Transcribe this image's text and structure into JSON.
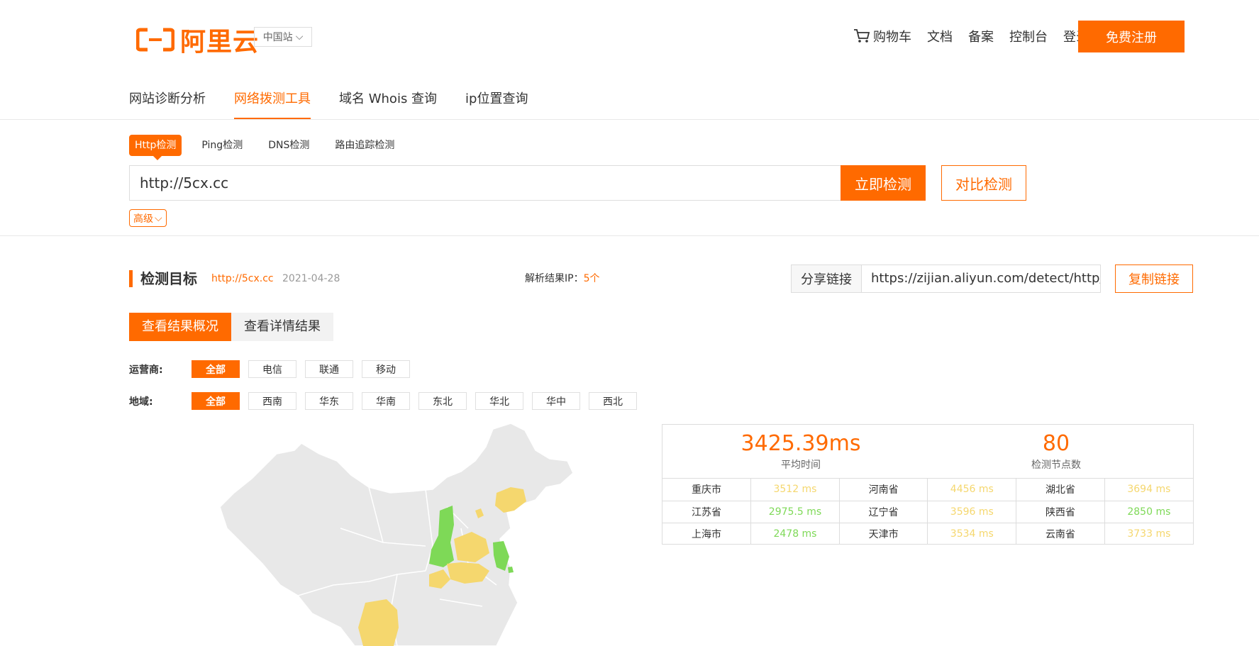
{
  "header": {
    "logo_text": "阿里云",
    "site_select": "中国站",
    "nav": {
      "cart": "购物车",
      "docs": "文档",
      "filing": "备案",
      "console": "控制台",
      "login": "登录"
    },
    "register_label": "免费注册"
  },
  "main_tabs": [
    "网站诊断分析",
    "网络拨测工具",
    "域名 Whois 查询",
    "ip位置查询"
  ],
  "sub_tabs": [
    "Http检测",
    "Ping检测",
    "DNS检测",
    "路由追踪检测"
  ],
  "search": {
    "value": "http://5cx.cc",
    "detect_label": "立即检测",
    "compare_label": "对比检测",
    "advanced_label": "高级"
  },
  "target": {
    "title": "检测目标",
    "url": "http://5cx.cc",
    "date": "2021-04-28",
    "ip_label": "解析结果IP：",
    "ip_count": "5个"
  },
  "share": {
    "label": "分享链接",
    "value": "https://zijian.aliyun.com/detect/http/HTT",
    "copy_label": "复制链接"
  },
  "view_tabs": [
    "查看结果概况",
    "查看详情结果"
  ],
  "filters": {
    "carrier_label": "运营商:",
    "carriers": [
      "全部",
      "电信",
      "联通",
      "移动"
    ],
    "region_label": "地域:",
    "regions": [
      "全部",
      "西南",
      "华东",
      "华南",
      "东北",
      "华北",
      "华中",
      "西北"
    ]
  },
  "stats": {
    "avg_time": "3425.39ms",
    "avg_time_label": "平均时间",
    "node_count": "80",
    "node_count_label": "检测节点数",
    "rows": [
      [
        {
          "city": "重庆市",
          "time": "3512 ms",
          "level": "yellow"
        },
        {
          "city": "河南省",
          "time": "4456 ms",
          "level": "yellow"
        },
        {
          "city": "湖北省",
          "time": "3694 ms",
          "level": "yellow"
        }
      ],
      [
        {
          "city": "江苏省",
          "time": "2975.5 ms",
          "level": "green"
        },
        {
          "city": "辽宁省",
          "time": "3596 ms",
          "level": "yellow"
        },
        {
          "city": "陕西省",
          "time": "2850 ms",
          "level": "green"
        }
      ],
      [
        {
          "city": "上海市",
          "time": "2478 ms",
          "level": "green"
        },
        {
          "city": "天津市",
          "time": "3534 ms",
          "level": "yellow"
        },
        {
          "city": "云南省",
          "time": "3733 ms",
          "level": "yellow"
        }
      ]
    ]
  },
  "colors": {
    "accent": "#ff6a00",
    "fast": "#7ed957",
    "medium": "#f5d76e",
    "map_base": "#e8e8e8"
  }
}
